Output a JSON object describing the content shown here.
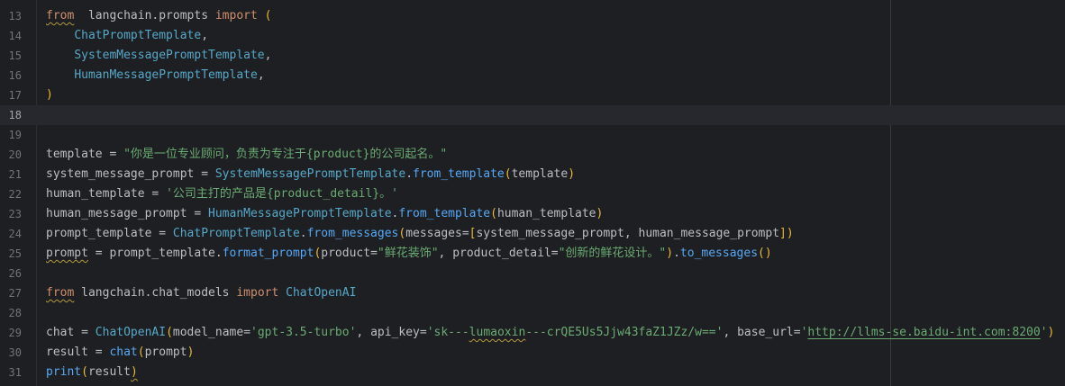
{
  "editor": {
    "lines": [
      {
        "num": "13",
        "parts": [
          [
            "kw squig",
            "from"
          ],
          [
            "",
            "  "
          ],
          [
            "var",
            "langchain.prompts"
          ],
          [
            "",
            " "
          ],
          [
            "kw",
            "import"
          ],
          [
            "",
            " "
          ],
          [
            "par",
            "("
          ]
        ]
      },
      {
        "num": "14",
        "parts": [
          [
            "",
            "    "
          ],
          [
            "cls",
            "ChatPromptTemplate"
          ],
          [
            "",
            ","
          ]
        ]
      },
      {
        "num": "15",
        "parts": [
          [
            "",
            "    "
          ],
          [
            "cls",
            "SystemMessagePromptTemplate"
          ],
          [
            "",
            ","
          ]
        ]
      },
      {
        "num": "16",
        "parts": [
          [
            "",
            "    "
          ],
          [
            "cls",
            "HumanMessagePromptTemplate"
          ],
          [
            "",
            ","
          ]
        ]
      },
      {
        "num": "17",
        "parts": [
          [
            "par",
            ")"
          ]
        ]
      },
      {
        "num": "18",
        "parts": [],
        "current": true
      },
      {
        "num": "19",
        "parts": []
      },
      {
        "num": "20",
        "parts": [
          [
            "var",
            "template"
          ],
          [
            "",
            " = "
          ],
          [
            "str",
            "\"你是一位专业顾问，负责为专注于{product}的公司起名。\""
          ]
        ]
      },
      {
        "num": "21",
        "parts": [
          [
            "var",
            "system_message_prompt"
          ],
          [
            "",
            " = "
          ],
          [
            "cls",
            "SystemMessagePromptTemplate"
          ],
          [
            "",
            "."
          ],
          [
            "fn",
            "from_template"
          ],
          [
            "par",
            "("
          ],
          [
            "var",
            "template"
          ],
          [
            "par",
            ")"
          ]
        ]
      },
      {
        "num": "22",
        "parts": [
          [
            "var",
            "human_template"
          ],
          [
            "",
            " = "
          ],
          [
            "str",
            "'公司主打的产品是{product_detail}。'"
          ]
        ]
      },
      {
        "num": "23",
        "parts": [
          [
            "var",
            "human_message_prompt"
          ],
          [
            "",
            " = "
          ],
          [
            "cls",
            "HumanMessagePromptTemplate"
          ],
          [
            "",
            "."
          ],
          [
            "fn",
            "from_template"
          ],
          [
            "par",
            "("
          ],
          [
            "var",
            "human_template"
          ],
          [
            "par",
            ")"
          ]
        ]
      },
      {
        "num": "24",
        "parts": [
          [
            "var",
            "prompt_template"
          ],
          [
            "",
            " = "
          ],
          [
            "cls",
            "ChatPromptTemplate"
          ],
          [
            "",
            "."
          ],
          [
            "fn",
            "from_messages"
          ],
          [
            "par",
            "("
          ],
          [
            "var",
            "messages"
          ],
          [
            "",
            "="
          ],
          [
            "brk",
            "["
          ],
          [
            "var",
            "system_message_prompt"
          ],
          [
            "",
            ", "
          ],
          [
            "var",
            "human_message_prompt"
          ],
          [
            "brk",
            "]"
          ],
          [
            "par",
            ")"
          ]
        ]
      },
      {
        "num": "25",
        "parts": [
          [
            "var squig",
            "prompt"
          ],
          [
            "",
            " = "
          ],
          [
            "var",
            "prompt_template"
          ],
          [
            "",
            "."
          ],
          [
            "fn",
            "format_prompt"
          ],
          [
            "par",
            "("
          ],
          [
            "var",
            "product"
          ],
          [
            "",
            "="
          ],
          [
            "str",
            "\"鲜花装饰\""
          ],
          [
            "",
            ", "
          ],
          [
            "var",
            "product_detail"
          ],
          [
            "",
            "="
          ],
          [
            "str",
            "\"创新的鲜花设计。\""
          ],
          [
            "par",
            ")"
          ],
          [
            "",
            "."
          ],
          [
            "fn",
            "to_messages"
          ],
          [
            "par",
            "()"
          ]
        ]
      },
      {
        "num": "26",
        "parts": []
      },
      {
        "num": "27",
        "parts": [
          [
            "kw squig",
            "from"
          ],
          [
            "",
            " "
          ],
          [
            "var",
            "langchain.chat_models"
          ],
          [
            "",
            " "
          ],
          [
            "kw",
            "import"
          ],
          [
            "",
            " "
          ],
          [
            "cls",
            "ChatOpenAI"
          ]
        ]
      },
      {
        "num": "28",
        "parts": []
      },
      {
        "num": "29",
        "parts": [
          [
            "var",
            "chat"
          ],
          [
            "",
            " = "
          ],
          [
            "cls",
            "ChatOpenAI"
          ],
          [
            "par",
            "("
          ],
          [
            "var",
            "model_name"
          ],
          [
            "",
            "="
          ],
          [
            "str",
            "'gpt-3.5-turbo'"
          ],
          [
            "",
            ", "
          ],
          [
            "var",
            "api_key"
          ],
          [
            "",
            "="
          ],
          [
            "str",
            "'sk---"
          ],
          [
            "str squig",
            "lumaoxin"
          ],
          [
            "str",
            "---crQE5Us5Jjw43faZ1JZz/w=='"
          ],
          [
            "",
            ", "
          ],
          [
            "var",
            "base_url"
          ],
          [
            "",
            "="
          ],
          [
            "str",
            "'"
          ],
          [
            "str link squig",
            "http://llms-se.baidu-int.com:8200"
          ],
          [
            "str",
            "'"
          ],
          [
            "par",
            ")"
          ]
        ]
      },
      {
        "num": "30",
        "parts": [
          [
            "var",
            "result"
          ],
          [
            "",
            " = "
          ],
          [
            "fn",
            "chat"
          ],
          [
            "par",
            "("
          ],
          [
            "var",
            "prompt"
          ],
          [
            "par",
            ")"
          ]
        ]
      },
      {
        "num": "31",
        "parts": [
          [
            "fn",
            "print"
          ],
          [
            "par",
            "("
          ],
          [
            "var",
            "result"
          ],
          [
            "par squig",
            ")"
          ]
        ]
      }
    ]
  }
}
